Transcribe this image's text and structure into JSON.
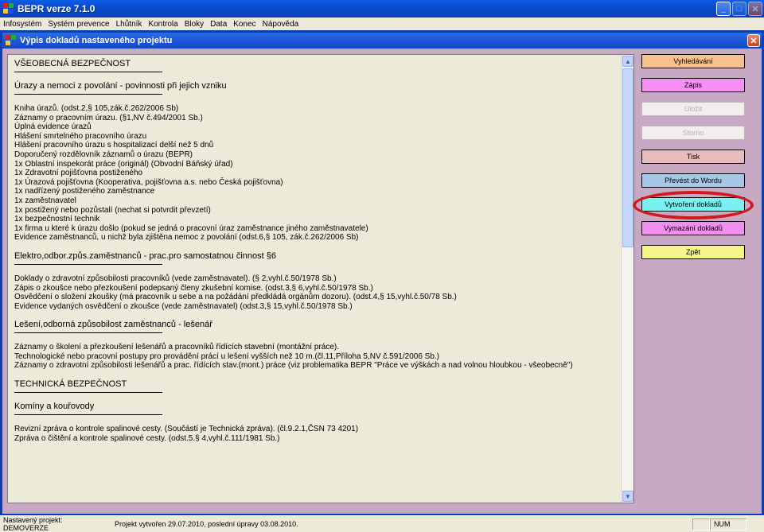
{
  "app": {
    "title": "BEPR verze 7.1.0",
    "menu": [
      "Infosystém",
      "Systém prevence",
      "Lhůtník",
      "Kontrola",
      "Bloky",
      "Data",
      "Konec",
      "Nápověda"
    ]
  },
  "child_window": {
    "title": "Výpis dokladů nastaveného projektu"
  },
  "document": {
    "sections": [
      {
        "heading": "VŠEOBECNÁ BEZPEČNOST",
        "lines": []
      },
      {
        "heading": "Úrazy a nemoci z povolání - povinnosti při jejich vzniku",
        "lines": [
          "Kniha úrazů.          (odst.2,§ 105,zák.č.262/2006 Sb)",
          "Záznamy o pracovním úrazu.        (§1,NV č.494/2001 Sb.)",
          "Úplná evidence úrazů",
          "Hlášení smrtelného pracovního úrazu",
          "Hlášení pracovního úrazu s hospitalizací delší než 5 dnů",
          "Doporučený rozdělovník záznamů o úrazu (BEPR)",
          "1x Oblastní inspekorát práce (originál) (Obvodní Báňský úřad)",
          "1x Zdravotní pojišťovna postiženého",
          "1x Úrazová pojišťovna (Kooperativa, pojišťovna a.s. nebo  Česká pojišťovna)",
          "1x nadřízený postiženého zaměstnance",
          "1x zaměstnavatel",
          "1x postižený nebo pozůstalí (nechat si potvrdit převzetí)",
          "1x bezpečnostní technik",
          "1x firma u které k úrazu došlo (pokud se jedná o pracovní  úraz zaměstnance jiného zaměstnavatele)",
          "Evidence zaměstnanců, u nichž byla zjištěna nemoc z povolání     (odst.6,§ 105, zák.č.262/2006 Sb)"
        ]
      },
      {
        "heading": "Elektro,odbor.způs.zaměstnanců -  prac.pro samostatnou činnost §6",
        "lines": [
          "Doklady o zdravotní způsobilosti pracovníků (vede zaměstnavatel).    (§ 2,vyhl.č.50/1978 Sb.)",
          "Zápis o zkoušce nebo přezkoušení podepsaný členy zkušební  komise.    (odst.3,§ 6,vyhl.č.50/1978 Sb.)",
          "Osvědčení o složení zkoušky (má pracovník u sebe a na požádání předkládá orgánům dozoru).   (odst.4,§ 15,vyhl.č.50/78 Sb.)",
          "Evidence vydaných osvědčení o zkoušce (vede zaměstnavatel)       (odst.3,§ 15,vyhl.č.50/1978 Sb.)"
        ]
      },
      {
        "heading": "Lešení,odborná způsobilost zaměstnanců - lešenář",
        "lines": [
          "Záznamy o školení a přezkoušení lešenářů a pracovníků řídících stavební (montážní práce).",
          "Technologické nebo pracovní postupy pro provádění prácí u lešení vyšších než 10 m.(čl.11,Příloha 5,NV č.591/2006 Sb.)",
          "Záznamy o zdravotní způsobilosti lešenářů a prac. řídících stav.(mont.) práce (viz problematika BEPR \"Práce ve výškách a nad volnou hloubkou - všeobecně\")"
        ]
      },
      {
        "heading": "TECHNICKÁ BEZPEČNOST",
        "lines": []
      },
      {
        "heading": "Komíny a kouřovody",
        "lines": [
          "Revizní zpráva o kontrole spalinové cesty. (Součástí je Technická zpráva).  (čl.9.2.1,ČSN 73 4201)",
          "Zpráva o čištění a kontrole spalinové cesty.  (odst.5.§ 4,vyhl.č.111/1981 Sb.)"
        ]
      }
    ]
  },
  "buttons": [
    {
      "label": "Vyhledávání",
      "color": "#f7c18f",
      "enabled": true
    },
    {
      "label": "Zápis",
      "color": "#f58ff2",
      "enabled": true
    },
    {
      "label": "Uložit",
      "color": "#f3eded",
      "enabled": false
    },
    {
      "label": "Storno",
      "color": "#f3eded",
      "enabled": false
    },
    {
      "label": "Tisk",
      "color": "#e8bcbc",
      "enabled": true
    },
    {
      "label": "Převést do Wordu",
      "color": "#a6c7e6",
      "enabled": true
    },
    {
      "label": "Vytvoření dokladů",
      "color": "#7cf0ef",
      "enabled": true
    },
    {
      "label": "Vymazání dokladů",
      "color": "#f18ff0",
      "enabled": true
    },
    {
      "label": "Zpět",
      "color": "#f5f58a",
      "enabled": true
    }
  ],
  "status": {
    "project": "Nastavený projekt: DEMOVERZE",
    "created": "Projekt vytvořen 29.07.2010, poslední úpravy 03.08.2010.",
    "num": "NUM"
  }
}
